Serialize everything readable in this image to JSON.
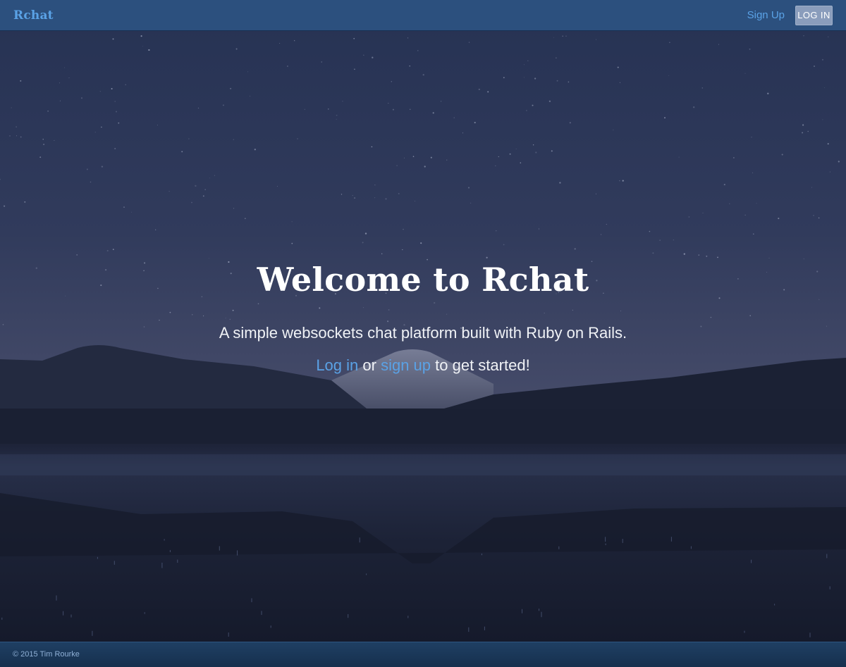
{
  "navbar": {
    "brand": "Rchat",
    "sign_up_label": "Sign Up",
    "log_in_label": "LOG IN"
  },
  "hero": {
    "title": "Welcome to Rchat",
    "subtitle": "A simple websockets chat platform built with Ruby on Rails.",
    "cta_login_link": "Log in",
    "cta_or": "or",
    "cta_signup_link": "sign up",
    "cta_suffix": "to get started!"
  },
  "footer": {
    "copyright": "© 2015 Tim Rourke"
  },
  "colors": {
    "link": "#5aa2e6",
    "navbar": "#2d5382",
    "login_button": "#8a9dbc",
    "sky_top": "#2a3556",
    "sky_bottom": "#434a6a"
  }
}
